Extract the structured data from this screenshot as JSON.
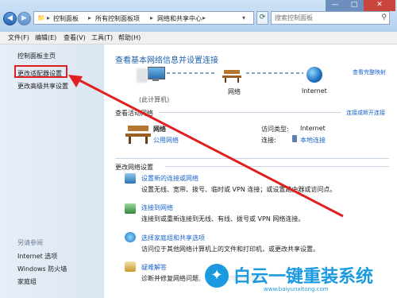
{
  "address": {
    "crumbs": [
      "控制面板",
      "所有控制面板项",
      "网络和共享中心"
    ],
    "search_placeholder": "搜索控制面板"
  },
  "menu": [
    "文件(F)",
    "编辑(E)",
    "查看(V)",
    "工具(T)",
    "帮助(H)"
  ],
  "sidebar": {
    "links": [
      "控制面板主页",
      "更改适配器设置",
      "更改高级共享设置"
    ],
    "see_also_title": "另请参阅",
    "see_also": [
      "Internet 选项",
      "Windows 防火墙",
      "家庭组"
    ]
  },
  "main": {
    "title": "查看基本网络信息并设置连接",
    "view_full_map": "查看完整映射",
    "map": {
      "computer_label": "(此计算机)",
      "network_label": "网络",
      "internet_label": "Internet"
    },
    "active_header": "查看活动网络",
    "connect_disconnect": "连接或断开连接",
    "network_name": "网络",
    "network_type": "公用网络",
    "access_type_label": "访问类型:",
    "access_type_value": "Internet",
    "connection_label": "连接:",
    "connection_value": "本地连接",
    "change_header": "更改网络设置",
    "tasks": [
      {
        "title": "设置新的连接或网络",
        "desc": "设置无线、宽带、拨号、临时或 VPN 连接；或设置路由器或访问点。",
        "icon": "network-setup-icon"
      },
      {
        "title": "连接到网络",
        "desc": "连接到或重新连接到无线、有线、拨号或 VPN 网络连接。",
        "icon": "connect-network-icon"
      },
      {
        "title": "选择家庭组和共享选项",
        "desc": "访问位于其他网络计算机上的文件和打印机，或更改共享设置。",
        "icon": "homegroup-icon"
      },
      {
        "title": "疑难解答",
        "desc": "诊断并修复网络问题，或获得故障排除信息。",
        "icon": "troubleshoot-icon"
      }
    ]
  },
  "watermark": {
    "brand": "白云一键重装系统",
    "url": "www.baiyunxitong.com"
  },
  "colors": {
    "highlight_box": "#e02020",
    "arrow": "#e02020",
    "link": "#1a63c8",
    "header": "#1e5fa8"
  }
}
